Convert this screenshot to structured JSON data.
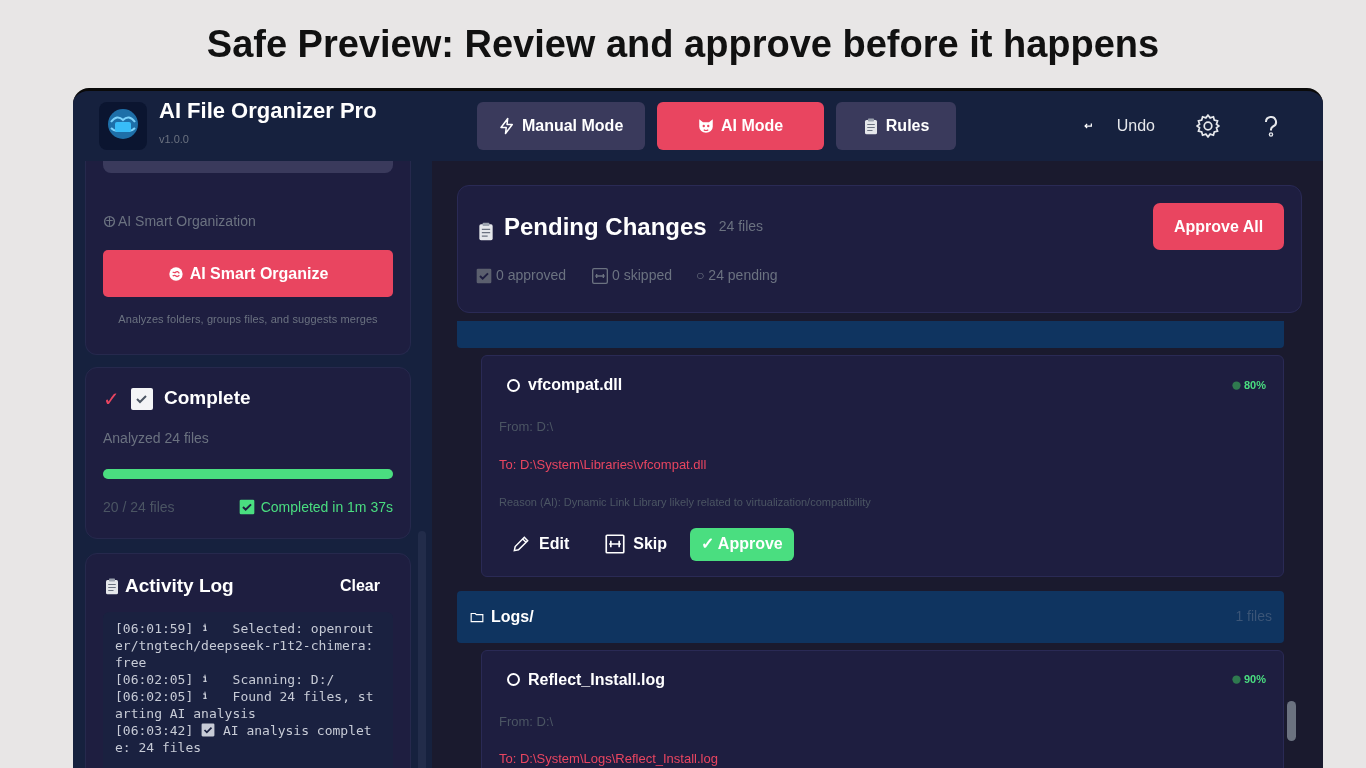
{
  "headline": "Safe Preview: Review and approve before it happens",
  "app": {
    "title": "AI File Organizer Pro",
    "version": "v1.0.0"
  },
  "tabs": [
    {
      "label": "Manual Mode",
      "selected": false
    },
    {
      "label": "AI Mode",
      "selected": true
    },
    {
      "label": "Rules",
      "selected": false
    }
  ],
  "undo": {
    "label": "Undo"
  },
  "sidebar": {
    "smart": {
      "section_label": "AI Smart Organization",
      "button": "AI Smart Organize",
      "hint": "Analyzes folders, groups files, and suggests merges"
    },
    "status": {
      "mark": "✓",
      "title": "Complete",
      "subtitle": "Analyzed 24 files",
      "level": 1,
      "count": "20 / 24 files",
      "done": "Completed in 1m 37s"
    },
    "log": {
      "title": "Activity Log",
      "clear": "Clear",
      "entries": [
        {
          "time": "[06:01:59]",
          "kind": "info",
          "message": "Selected: openrouter/tngtech/deepseek-r1t2-chimera:free"
        },
        {
          "time": "[06:02:05]",
          "kind": "info",
          "message": "Scanning: D:/"
        },
        {
          "time": "[06:02:05]",
          "kind": "info",
          "message": "Found 24 files, starting AI analysis"
        },
        {
          "time": "[06:03:42]",
          "kind": "success",
          "message": "AI analysis complete: 24 files"
        }
      ]
    }
  },
  "pending": {
    "title": "Pending Changes",
    "count": "24 files",
    "approve_all": "Approve All",
    "approved": "0 approved",
    "skipped": "0 skipped",
    "pending_mark": "○",
    "pending": "24 pending"
  },
  "groups": [
    {
      "files": [
        {
          "name": "vfcompat.dll",
          "selected": false,
          "confidence": "80%",
          "from": "From: D:\\",
          "to": "To: D:\\System\\Libraries\\vfcompat.dll",
          "reason": "Reason (AI): Dynamic Link Library likely related to virtualization/compatibility",
          "actions": [
            "Edit",
            "Skip",
            "✓ Approve"
          ]
        }
      ]
    },
    {
      "name": "Logs/",
      "count": "1 files",
      "files": [
        {
          "name": "Reflect_Install.log",
          "selected": false,
          "confidence": "90%",
          "from": "From: D:\\",
          "to": "To: D:\\System\\Logs\\Reflect_Install.log"
        }
      ]
    }
  ]
}
